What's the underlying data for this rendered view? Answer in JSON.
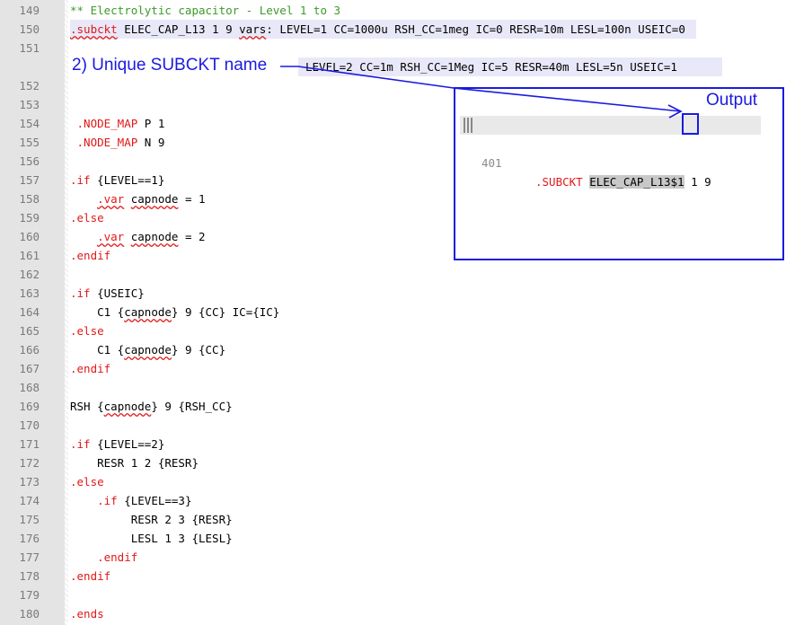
{
  "lines": [
    {
      "num": "149",
      "segs": [
        {
          "t": "** Electrolytic capacitor - Level 1 to 3",
          "c": "green"
        }
      ]
    },
    {
      "num": "150",
      "hl": true,
      "segs": [
        {
          "t": ".subckt",
          "c": "red wavy"
        },
        {
          "t": " ELEC_CAP_L13 1 9 ",
          "c": ""
        },
        {
          "t": "vars",
          "c": "wavy"
        },
        {
          "t": ": LEVEL=1 CC=1000u RSH_CC=1meg IC=0 RESR=10m LESL=100n USEIC=0",
          "c": ""
        }
      ]
    },
    {
      "num": "151",
      "segs": []
    },
    {
      "num": "152",
      "segs": []
    },
    {
      "num": "153",
      "segs": []
    },
    {
      "num": "154",
      "segs": [
        {
          "t": " .NODE_MAP",
          "c": "red"
        },
        {
          "t": " P 1",
          "c": ""
        }
      ]
    },
    {
      "num": "155",
      "segs": [
        {
          "t": " .NODE_MAP",
          "c": "red"
        },
        {
          "t": " N 9",
          "c": ""
        }
      ]
    },
    {
      "num": "156",
      "segs": []
    },
    {
      "num": "157",
      "segs": [
        {
          "t": ".if",
          "c": "red"
        },
        {
          "t": " {LEVEL==1}",
          "c": ""
        }
      ]
    },
    {
      "num": "158",
      "segs": [
        {
          "t": "    ",
          "c": ""
        },
        {
          "t": ".var",
          "c": "red wavy"
        },
        {
          "t": " ",
          "c": ""
        },
        {
          "t": "capnode",
          "c": "wavy"
        },
        {
          "t": " = 1",
          "c": ""
        }
      ]
    },
    {
      "num": "159",
      "segs": [
        {
          "t": ".else",
          "c": "red"
        }
      ]
    },
    {
      "num": "160",
      "segs": [
        {
          "t": "    ",
          "c": ""
        },
        {
          "t": ".var",
          "c": "red wavy"
        },
        {
          "t": " ",
          "c": ""
        },
        {
          "t": "capnode",
          "c": "wavy"
        },
        {
          "t": " = 2",
          "c": ""
        }
      ]
    },
    {
      "num": "161",
      "segs": [
        {
          "t": ".endif",
          "c": "red"
        }
      ]
    },
    {
      "num": "162",
      "segs": []
    },
    {
      "num": "163",
      "segs": [
        {
          "t": ".if",
          "c": "red"
        },
        {
          "t": " {USEIC}",
          "c": ""
        }
      ]
    },
    {
      "num": "164",
      "segs": [
        {
          "t": "    C1 {",
          "c": ""
        },
        {
          "t": "capnode",
          "c": "wavy"
        },
        {
          "t": "} 9 {CC} IC={IC}",
          "c": ""
        }
      ]
    },
    {
      "num": "165",
      "segs": [
        {
          "t": ".else",
          "c": "red"
        }
      ]
    },
    {
      "num": "166",
      "segs": [
        {
          "t": "    C1 {",
          "c": ""
        },
        {
          "t": "capnode",
          "c": "wavy"
        },
        {
          "t": "} 9 {CC}",
          "c": ""
        }
      ]
    },
    {
      "num": "167",
      "segs": [
        {
          "t": ".endif",
          "c": "red"
        }
      ]
    },
    {
      "num": "168",
      "segs": []
    },
    {
      "num": "169",
      "segs": [
        {
          "t": "RSH {",
          "c": ""
        },
        {
          "t": "capnode",
          "c": "wavy"
        },
        {
          "t": "} 9 {RSH_CC}",
          "c": ""
        }
      ]
    },
    {
      "num": "170",
      "segs": []
    },
    {
      "num": "171",
      "segs": [
        {
          "t": ".if",
          "c": "red"
        },
        {
          "t": " {LEVEL==2}",
          "c": ""
        }
      ]
    },
    {
      "num": "172",
      "segs": [
        {
          "t": "    RESR 1 2 {RESR}",
          "c": ""
        }
      ]
    },
    {
      "num": "173",
      "segs": [
        {
          "t": ".else",
          "c": "red"
        }
      ]
    },
    {
      "num": "174",
      "segs": [
        {
          "t": "    ",
          "c": ""
        },
        {
          "t": ".if",
          "c": "red"
        },
        {
          "t": " {LEVEL==3}",
          "c": ""
        }
      ]
    },
    {
      "num": "175",
      "segs": [
        {
          "t": "         RESR 2 3 {RESR}",
          "c": ""
        }
      ]
    },
    {
      "num": "176",
      "segs": [
        {
          "t": "         LESL 1 3 {LESL}",
          "c": ""
        }
      ]
    },
    {
      "num": "177",
      "segs": [
        {
          "t": "    ",
          "c": ""
        },
        {
          "t": ".endif",
          "c": "red"
        }
      ]
    },
    {
      "num": "178",
      "segs": [
        {
          "t": ".endif",
          "c": "red"
        }
      ]
    },
    {
      "num": "179",
      "segs": []
    },
    {
      "num": "180",
      "segs": [
        {
          "t": ".ends",
          "c": "red"
        }
      ]
    }
  ],
  "annotation": {
    "label": "2) Unique SUBCKT name"
  },
  "new_line": {
    "text": "LEVEL=2 CC=1m RSH_CC=1Meg IC=5 RESR=40m LESL=5n USEIC=1"
  },
  "output": {
    "label": "Output",
    "line_num": "401",
    "keyword": ".SUBCKT",
    "name": "ELEC_CAP_L13",
    "suffix": "$1",
    "rest": " 1 9"
  },
  "colors": {
    "keyword": "#e01818",
    "comment": "#3a9a28",
    "annotation": "#1a1ae0",
    "highlight": "#e8e8f8"
  }
}
